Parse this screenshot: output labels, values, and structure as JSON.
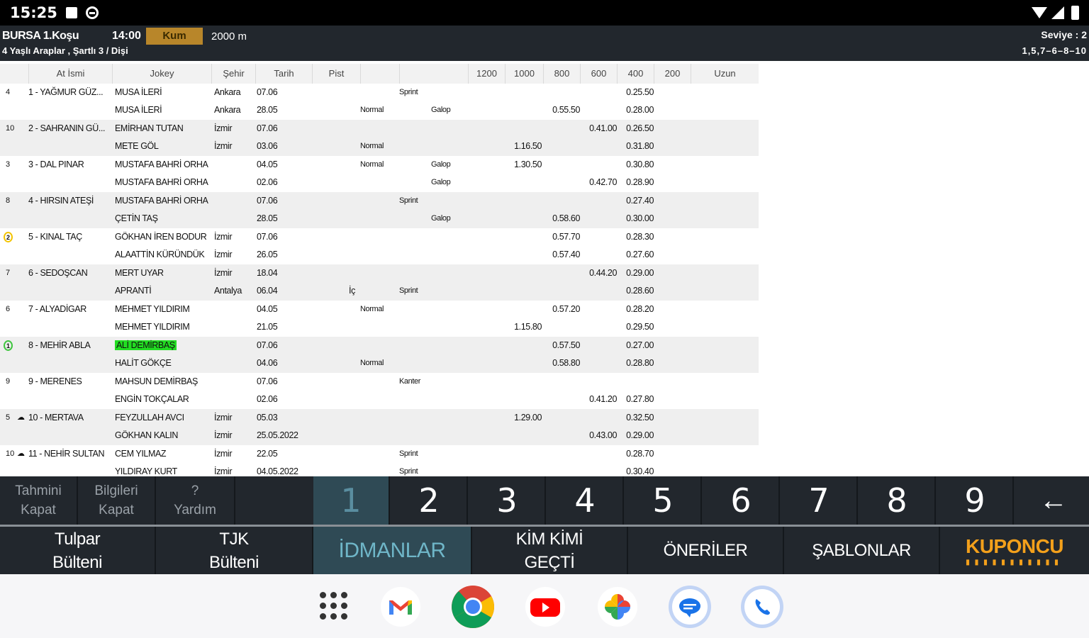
{
  "status_bar": {
    "time": "15:25"
  },
  "race": {
    "city": "BURSA 1.Koşu",
    "time": "14:00",
    "surface": "Kum",
    "distance": "2000 m",
    "subtitle": "4 Yaşlı Araplar , Şartlı 3 / Dişi",
    "level": "Seviye : 2",
    "sequence": "1,5,7–6–8–10"
  },
  "table": {
    "headers": [
      "At İsmi",
      "Jokey",
      "Şehir",
      "Tarih",
      "Pist",
      "",
      "",
      "1200",
      "1000",
      "800",
      "600",
      "400",
      "200",
      "Uzun"
    ],
    "rows": [
      {
        "num": "4",
        "horse": "1 - YAĞMUR GÜZ...",
        "line1": {
          "jockey": "MUSA İLERİ",
          "city": "Ankara",
          "date": "07.06",
          "c6": "Sprint",
          "c400": "0.25.50"
        },
        "line2": {
          "jockey": "MUSA İLERİ",
          "city": "Ankara",
          "date": "28.05",
          "c5": "Normal",
          "c7": "Galop",
          "c800": "0.55.50",
          "c400": "0.28.00"
        }
      },
      {
        "num": "10",
        "horse": "2 - SAHRANIN GÜ...",
        "line1": {
          "jockey": "EMİRHAN TUTAN",
          "city": "İzmir",
          "date": "07.06",
          "c600": "0.41.00",
          "c400": "0.26.50"
        },
        "line2": {
          "jockey": "METE GÖL",
          "city": "İzmir",
          "date": "03.06",
          "c5": "Normal",
          "c1000": "1.16.50",
          "c400": "0.31.80"
        }
      },
      {
        "num": "3",
        "horse": "3 - DAL PINAR",
        "line1": {
          "jockey": "MUSTAFA BAHRİ ORHA",
          "city": "",
          "date": "04.05",
          "c5": "Normal",
          "c7": "Galop",
          "c1000": "1.30.50",
          "c400": "0.30.80"
        },
        "line2": {
          "jockey": "MUSTAFA BAHRİ ORHA",
          "city": "",
          "date": "02.06",
          "c7": "Galop",
          "c600": "0.42.70",
          "c400": "0.28.90"
        }
      },
      {
        "num": "8",
        "horse": "4 - HIRSIN ATEŞİ",
        "line1": {
          "jockey": "MUSTAFA BAHRİ ORHA",
          "city": "",
          "date": "07.06",
          "c6": "Sprint",
          "c400": "0.27.40"
        },
        "line2": {
          "jockey": "ÇETİN TAŞ",
          "city": "",
          "date": "28.05",
          "c7": "Galop",
          "c800": "0.58.60",
          "c400": "0.30.00"
        }
      },
      {
        "num": "2",
        "horse": "5 - KINAL TAÇ",
        "badge": "yellow",
        "line1": {
          "jockey": "GÖKHAN İREN BODUR",
          "city": "İzmir",
          "date": "07.06",
          "c800": "0.57.70",
          "c400": "0.28.30"
        },
        "line2": {
          "jockey": "ALAATTİN KÜRÜNDÜK",
          "city": "İzmir",
          "date": "26.05",
          "c800": "0.57.40",
          "c400": "0.27.60"
        }
      },
      {
        "num": "7",
        "horse": "6 - SEDOŞCAN",
        "line1": {
          "jockey": "MERT UYAR",
          "city": "İzmir",
          "date": "18.04",
          "c600": "0.44.20",
          "c400": "0.29.00"
        },
        "line2": {
          "jockey": "APRANTİ",
          "city": "Antalya",
          "date": "06.04",
          "pist": "İç",
          "c6": "Sprint",
          "c400": "0.28.60"
        }
      },
      {
        "num": "6",
        "horse": "7 - ALYADİGAR",
        "line1": {
          "jockey": "MEHMET YILDIRIM",
          "city": "",
          "date": "04.05",
          "c5": "Normal",
          "c800": "0.57.20",
          "c400": "0.28.20"
        },
        "line2": {
          "jockey": "MEHMET YILDIRIM",
          "city": "",
          "date": "21.05",
          "c1000": "1.15.80",
          "c400": "0.29.50"
        }
      },
      {
        "num": "1",
        "horse": "8 - MEHİR ABLA",
        "badge": "green",
        "line1": {
          "jockey": "ALİ DEMİRBAŞ",
          "jockey_highlight": true,
          "city": "",
          "date": "07.06",
          "c800": "0.57.50",
          "c400": "0.27.00"
        },
        "line2": {
          "jockey": "HALİT GÖKÇE",
          "city": "",
          "date": "04.06",
          "c5": "Normal",
          "c800": "0.58.80",
          "c400": "0.28.80"
        }
      },
      {
        "num": "9",
        "horse": "9 - MERENES",
        "line1": {
          "jockey": "MAHSUN DEMİRBAŞ",
          "city": "",
          "date": "07.06",
          "c6": "Kanter",
          "c400": ""
        },
        "line2": {
          "jockey": "ENGİN TOKÇALAR",
          "city": "",
          "date": "02.06",
          "c600": "0.41.20",
          "c400": "0.27.80"
        }
      },
      {
        "num": "5",
        "horse": "10 - MERTAVA",
        "blinker": true,
        "line1": {
          "jockey": "FEYZULLAH AVCI",
          "city": "İzmir",
          "date": "05.03",
          "c1000": "1.29.00",
          "c400": "0.32.50"
        },
        "line2": {
          "jockey": "GÖKHAN KALIN",
          "city": "İzmir",
          "date": "25.05.2022",
          "c600": "0.43.00",
          "c400": "0.29.00"
        }
      },
      {
        "num": "10",
        "horse": "11 - NEHİR SULTAN",
        "blinker": true,
        "line1": {
          "jockey": "CEM YILMAZ",
          "city": "İzmir",
          "date": "22.05",
          "c6": "Sprint",
          "c400": "0.28.70"
        },
        "line2": {
          "jockey": "YILDIRAY KURT",
          "city": "İzmir",
          "date": "04.05.2022",
          "c6": "Sprint",
          "c400": "0.30.40"
        }
      }
    ]
  },
  "keypad": {
    "tahmini": [
      "Tahmini",
      "Kapat"
    ],
    "bilgileri": [
      "Bilgileri",
      "Kapat"
    ],
    "yardim": [
      "?",
      "Yardım"
    ],
    "numbers": [
      "1",
      "2",
      "3",
      "4",
      "5",
      "6",
      "7",
      "8",
      "9"
    ],
    "active": "1",
    "back": "←"
  },
  "tabs": {
    "tulpar": [
      "Tulpar",
      "Bülteni"
    ],
    "tjk": [
      "TJK",
      "Bülteni"
    ],
    "idmanlar": "İDMANLAR",
    "kimkimi": [
      "KİM KİMİ",
      "GEÇTİ"
    ],
    "oneriler": "ÖNERİLER",
    "sablonlar": "ŞABLONLAR",
    "kuponcu": "KUPONCU",
    "kuponcu_dots": "▮▮▮▮▮▮▮▮▮▮▮"
  },
  "dock": [
    "apps-icon",
    "gmail-icon",
    "chrome-icon",
    "youtube-icon",
    "photos-icon",
    "messages-icon",
    "phone-icon"
  ]
}
